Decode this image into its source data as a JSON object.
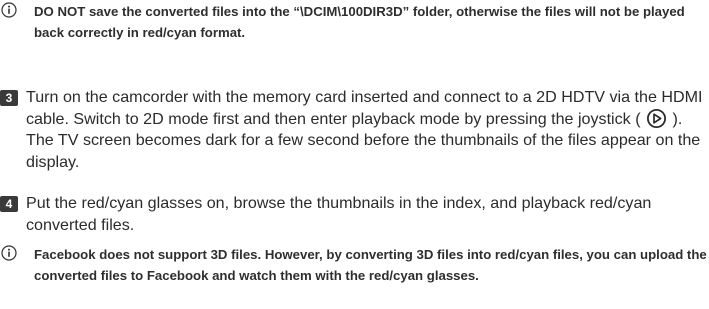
{
  "note1": {
    "icon": "info-circle-icon",
    "text": "DO NOT save the converted files into the “\\DCIM\\100DIR3D” folder, otherwise the files will not be played back correctly in red/cyan format."
  },
  "step3": {
    "number": "3",
    "text_before_icon": "Turn on the camcorder with the memory card inserted and connect to a 2D HDTV via the HDMI cable. Switch to 2D mode first and then enter playback mode by pressing the joystick (",
    "icon": "joystick-play-icon",
    "text_after_icon": "). The TV screen becomes dark for a few second before the thumbnails of the files appear on the display."
  },
  "step4": {
    "number": "4",
    "text": "Put the red/cyan glasses on, browse the thumbnails in the index, and playback red/cyan converted files."
  },
  "note2": {
    "icon": "info-circle-icon",
    "text": "Facebook does not support 3D files. However, by converting 3D files into red/cyan files, you can upload the converted files to Facebook and watch them with the red/cyan glasses."
  }
}
